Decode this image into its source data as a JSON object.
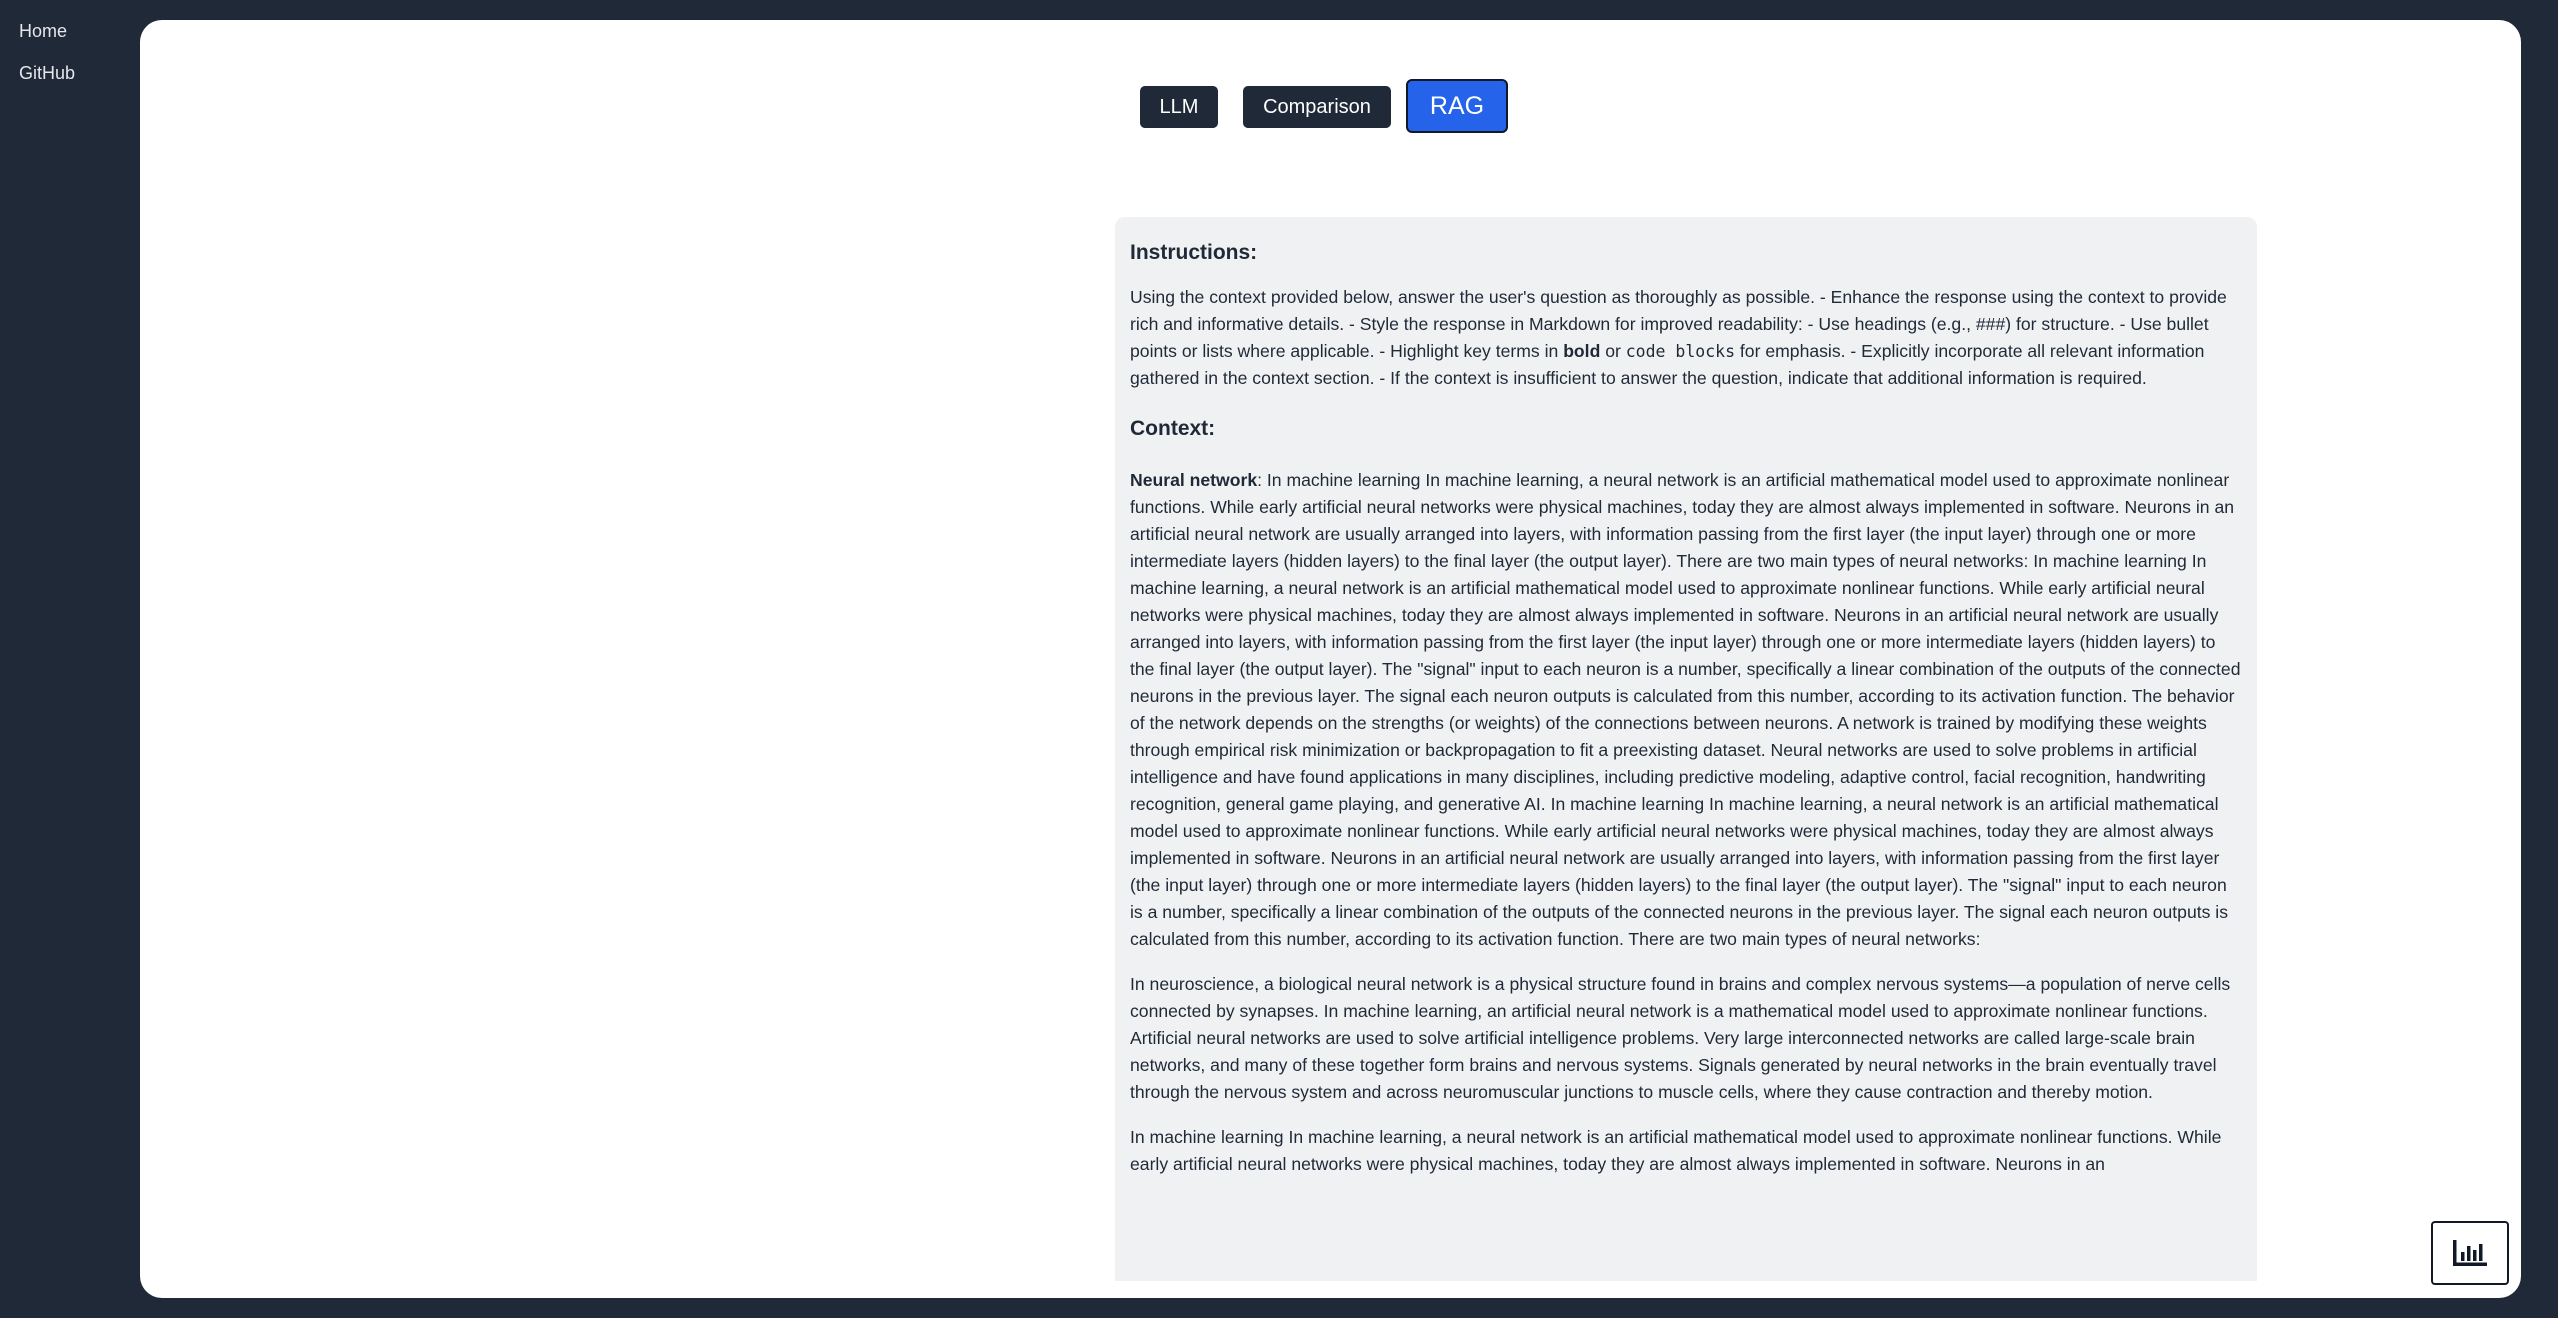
{
  "sidebar": {
    "home_label": "Home",
    "github_label": "GitHub"
  },
  "tabs": {
    "llm_label": "LLM",
    "comparison_label": "Comparison",
    "rag_label": "RAG",
    "active": "RAG"
  },
  "prompt": {
    "instructions_heading": "Instructions:",
    "instructions_text_1": "Using the context provided below, answer the user's question as thoroughly as possible. - Enhance the response using the context to provide rich and informative details. - Style the response in Markdown for improved readability: - Use headings (e.g., ###) for structure. - Use bullet points or lists where applicable. - Highlight key terms in ",
    "instructions_bold": "bold",
    "instructions_or": " or ",
    "instructions_code": "code blocks",
    "instructions_text_2": " for emphasis. - Explicitly incorporate all relevant information gathered in the context section. - If the context is insufficient to answer the question, indicate that additional information is required.",
    "context_heading": "Context:",
    "neural_term": "Neural network",
    "neural_text": ": In machine learning In machine learning, a neural network is an artificial mathematical model used to approximate nonlinear functions. While early artificial neural networks were physical machines, today they are almost always implemented in software. Neurons in an artificial neural network are usually arranged into layers, with information passing from the first layer (the input layer) through one or more intermediate layers (hidden layers) to the final layer (the output layer). There are two main types of neural networks: In machine learning In machine learning, a neural network is an artificial mathematical model used to approximate nonlinear functions. While early artificial neural networks were physical machines, today they are almost always implemented in software. Neurons in an artificial neural network are usually arranged into layers, with information passing from the first layer (the input layer) through one or more intermediate layers (hidden layers) to the final layer (the output layer). The \"signal\" input to each neuron is a number, specifically a linear combination of the outputs of the connected neurons in the previous layer. The signal each neuron outputs is calculated from this number, according to its activation function. The behavior of the network depends on the strengths (or weights) of the connections between neurons. A network is trained by modifying these weights through empirical risk minimization or backpropagation to fit a preexisting dataset. Neural networks are used to solve problems in artificial intelligence and have found applications in many disciplines, including predictive modeling, adaptive control, facial recognition, handwriting recognition, general game playing, and generative AI. In machine learning In machine learning, a neural network is an artificial mathematical model used to approximate nonlinear functions. While early artificial neural networks were physical machines, today they are almost always implemented in software. Neurons in an artificial neural network are usually arranged into layers, with information passing from the first layer (the input layer) through one or more intermediate layers (hidden layers) to the final layer (the output layer). The \"signal\" input to each neuron is a number, specifically a linear combination of the outputs of the connected neurons in the previous layer. The signal each neuron outputs is calculated from this number, according to its activation function. There are two main types of neural networks:",
    "neuroscience_text": "In neuroscience, a biological neural network is a physical structure found in brains and complex nervous systems—a population of nerve cells connected by synapses. In machine learning, an artificial neural network is a mathematical model used to approximate nonlinear functions. Artificial neural networks are used to solve artificial intelligence problems. Very large interconnected networks are called large-scale brain networks, and many of these together form brains and nervous systems. Signals generated by neural networks in the brain eventually travel through the nervous system and across neuromuscular junctions to muscle cells, where they cause contraction and thereby motion.",
    "ml_text": "In machine learning In machine learning, a neural network is an artificial mathematical model used to approximate nonlinear functions. While early artificial neural networks were physical machines, today they are almost always implemented in software. Neurons in an"
  },
  "icons": {
    "stats_button_icon": "bar-chart-icon"
  },
  "colors": {
    "background": "#1f2937",
    "panel": "#ffffff",
    "prompt_box": "#f0f1f3",
    "tab_default": "#1f2937",
    "tab_active": "#2563eb"
  }
}
